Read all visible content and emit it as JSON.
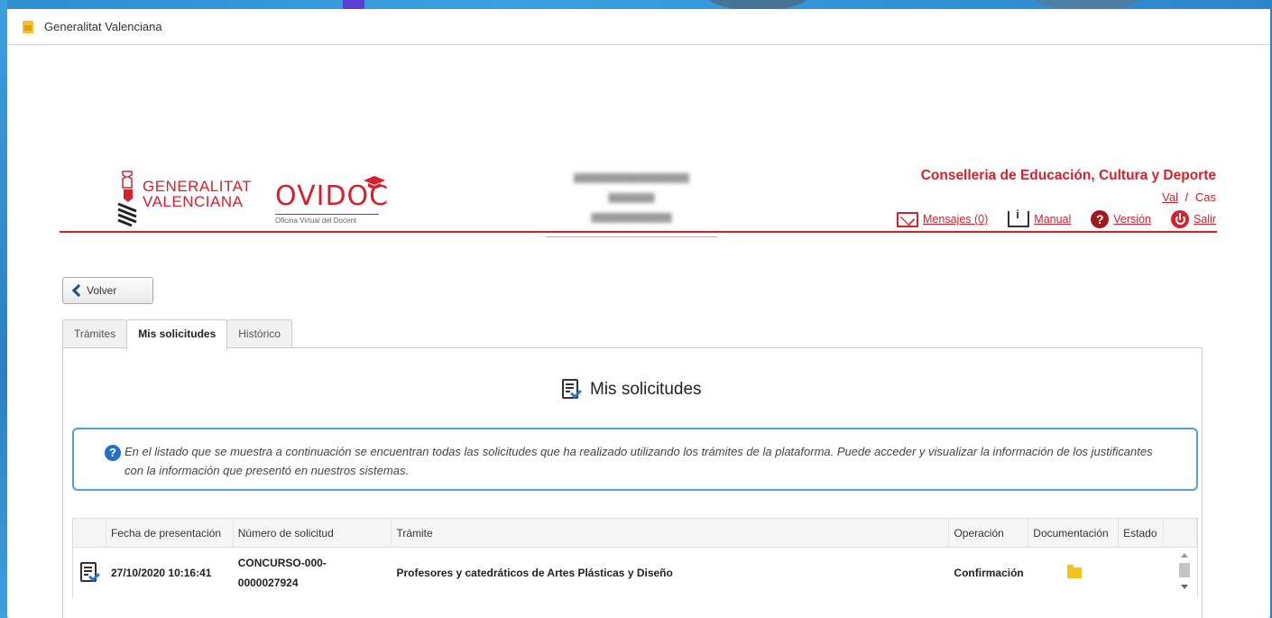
{
  "window": {
    "title": "Generalitat Valenciana"
  },
  "header": {
    "logo_line1": "GENERALITAT",
    "logo_line2": "VALENCIANA",
    "app_name": "OVIDOC",
    "app_subtitle": "Oficina Virtual del Docent",
    "conselleria": "Conselleria de Educación, Cultura y Deporte",
    "lang_val": "Val",
    "lang_sep": "/",
    "lang_cas": "Cas",
    "links": {
      "messages": "Mensajes (0)",
      "manual": "Manual",
      "version": "Versión",
      "exit": "Salir"
    }
  },
  "back_button": {
    "label": "Volver"
  },
  "tabs": [
    {
      "label": "Trámites",
      "active": false
    },
    {
      "label": "Mis solicitudes",
      "active": true
    },
    {
      "label": "Histórico",
      "active": false
    }
  ],
  "panel": {
    "title": "Mis solicitudes",
    "info_text": "En el listado que se muestra a continuación se encuentran todas las solicitudes que ha realizado utilizando los trámites de la plataforma. Puede acceder y visualizar la información de los justificantes con la información que presentó en nuestros sistemas."
  },
  "table": {
    "columns": [
      "",
      "Fecha de presentación",
      "Número de solicitud",
      "Trámite",
      "Operación",
      "Documentación",
      "Estado"
    ],
    "rows": [
      {
        "fecha": "27/10/2020 10:16:41",
        "numero_line1": "CONCURSO-000-",
        "numero_line2": "0000027924",
        "tramite": "Profesores y catedráticos de Artes Plásticas y Diseño",
        "operacion": "Confirmación",
        "estado": ""
      }
    ]
  },
  "icons": {
    "accent": "#d6202e",
    "info": "#2470c7"
  }
}
